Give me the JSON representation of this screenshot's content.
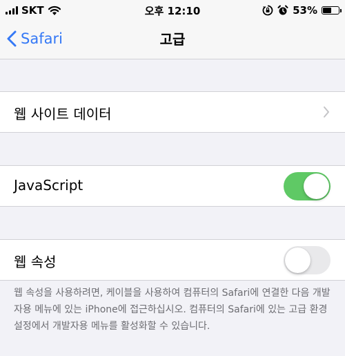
{
  "status_bar": {
    "carrier": "SKT",
    "time": "오후 12:10",
    "battery": "53%",
    "battery_level": 0.53,
    "icons": [
      "signal-icon",
      "wifi-icon",
      "orientation-lock-icon",
      "alarm-icon",
      "battery-icon"
    ]
  },
  "nav": {
    "back_label": "Safari",
    "title": "고급"
  },
  "rows": {
    "website_data": {
      "label": "웹 사이트 데이터"
    },
    "javascript": {
      "label": "JavaScript",
      "enabled": true
    },
    "web_inspector": {
      "label": "웹 속성",
      "enabled": false
    }
  },
  "footer": {
    "text": "웹 속성을 사용하려면, 케이블을 사용하여 컴퓨터의 Safari에 연결한 다음 개발자용 메뉴에 있는 iPhone에 접근하십시오. 컴퓨터의 Safari에 있는 고급 환경설정에서 개발자용 메뉴를 활성화할 수 있습니다."
  },
  "colors": {
    "accent": "#3478f6",
    "toggle_on": "#5fc965",
    "toggle_off": "#e9e9eb",
    "background": "#f2f2f7"
  }
}
